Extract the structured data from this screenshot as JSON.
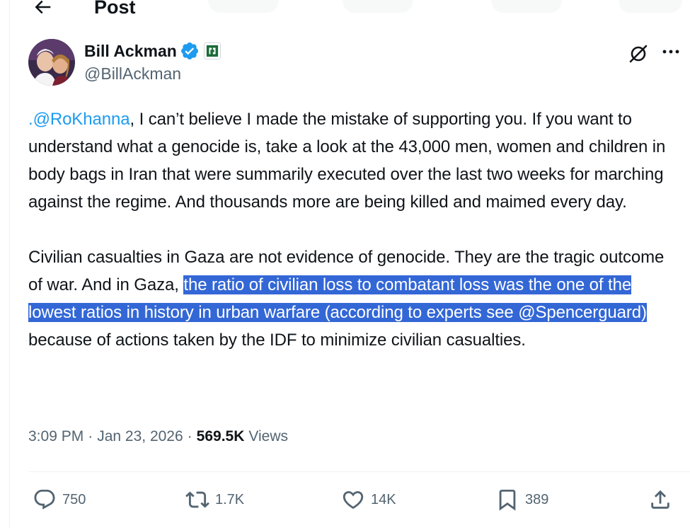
{
  "header": {
    "title": "Post"
  },
  "author": {
    "name": "Bill Ackman",
    "handle": "@BillAckman"
  },
  "tweet": {
    "p1_mention": ".@RoKhanna",
    "p1_text": ", I can’t believe I made the mistake of supporting you. If you want to understand what a genocide is, take a look at the 43,000 men, women and children in body bags in Iran that were summarily executed over the last two weeks for marching against the regime. And thousands more are being killed and maimed every day.",
    "p2_before": "Civilian casualties in Gaza are not evidence of genocide. They are the tragic outcome of war. And in Gaza, ",
    "p2_highlight": "the ratio of civilian loss to combatant loss was the one of the lowest ratios in history in urban warfare (according to experts see @Spencerguard)",
    "p2_after": " because of actions taken by the IDF to minimize civilian casualties."
  },
  "meta": {
    "time": "3:09 PM",
    "sep1": "·",
    "date": "Jan 23, 2026",
    "sep2": "·",
    "views_count": "569.5K",
    "views_label": "Views"
  },
  "actions": {
    "replies": "750",
    "reposts": "1.7K",
    "likes": "14K",
    "bookmarks": "389"
  },
  "colors": {
    "accent": "#1d9bf0",
    "text": "#0f1419",
    "secondary": "#536471",
    "selection": "#3367d6"
  },
  "icons": [
    "back-arrow-icon",
    "verified-badge-icon",
    "affiliation-badge-icon",
    "grok-icon",
    "more-icon",
    "reply-icon",
    "repost-icon",
    "like-icon",
    "bookmark-icon",
    "share-icon"
  ]
}
